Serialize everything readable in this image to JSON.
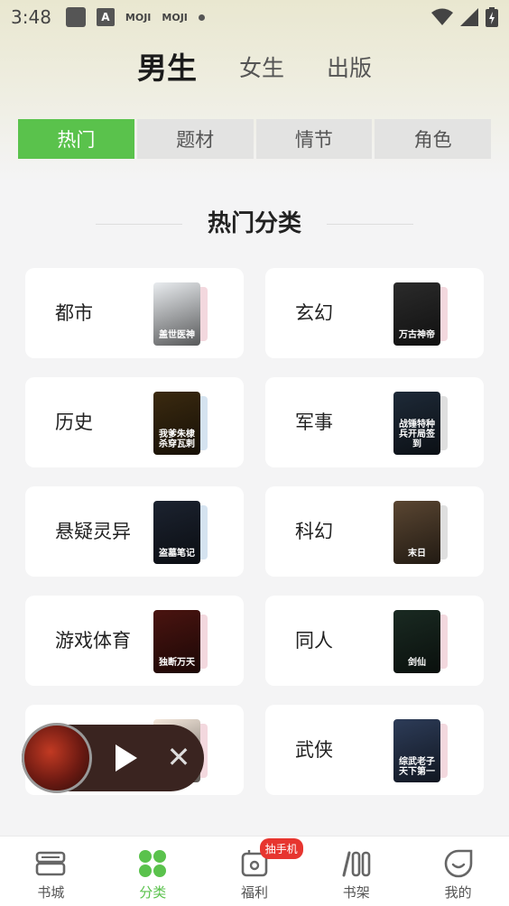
{
  "status_bar": {
    "time": "3:48",
    "icons": [
      "square-icon",
      "a-icon",
      "moji-icon",
      "moji-icon",
      "dot-icon"
    ],
    "moji_label": "MOJI"
  },
  "gender_tabs": [
    {
      "label": "男生",
      "active": true
    },
    {
      "label": "女生",
      "active": false
    },
    {
      "label": "出版",
      "active": false
    }
  ],
  "segments": [
    {
      "label": "热门",
      "active": true
    },
    {
      "label": "题材",
      "active": false
    },
    {
      "label": "情节",
      "active": false
    },
    {
      "label": "角色",
      "active": false
    }
  ],
  "section_title": "热门分类",
  "categories": [
    {
      "label": "都市",
      "cover_text": "盖世医神",
      "cover_color": "#e9ecef",
      "back_color": "#f3d8de"
    },
    {
      "label": "玄幻",
      "cover_text": "万古神帝",
      "cover_color": "#2b2b2b",
      "back_color": "#f3d8de"
    },
    {
      "label": "历史",
      "cover_text": "我爹朱棣杀穿瓦剌",
      "cover_color": "#3b2a10",
      "back_color": "#d5e3f0"
    },
    {
      "label": "军事",
      "cover_text": "战锤特种兵开局签到",
      "cover_color": "#1e2a38",
      "back_color": "#dfdfdf"
    },
    {
      "label": "悬疑灵异",
      "cover_text": "盗墓笔记",
      "cover_color": "#1c2330",
      "back_color": "#d5e3f0"
    },
    {
      "label": "科幻",
      "cover_text": "末日",
      "cover_color": "#5a4632",
      "back_color": "#dfdfdf"
    },
    {
      "label": "游戏体育",
      "cover_text": "独断万天",
      "cover_color": "#4a1410",
      "back_color": "#f3d8de"
    },
    {
      "label": "同人",
      "cover_text": "剑仙",
      "cover_color": "#1a2a22",
      "back_color": "#f3d8de"
    },
    {
      "label": "",
      "cover_text": "",
      "cover_color": "#f5e8dc",
      "back_color": "#f3d8de"
    },
    {
      "label": "武侠",
      "cover_text": "综武老子天下第一",
      "cover_color": "#2d3c58",
      "back_color": "#f3d8de"
    }
  ],
  "player": {
    "state": "paused"
  },
  "tabbar": [
    {
      "label": "书城",
      "icon": "bookstore-icon",
      "active": false
    },
    {
      "label": "分类",
      "icon": "category-icon",
      "active": true
    },
    {
      "label": "福利",
      "icon": "gift-icon",
      "active": false,
      "badge": "抽手机"
    },
    {
      "label": "书架",
      "icon": "bookshelf-icon",
      "active": false
    },
    {
      "label": "我的",
      "icon": "profile-icon",
      "active": false
    }
  ],
  "colors": {
    "accent": "#5ac24c",
    "badge": "#e7352f"
  }
}
